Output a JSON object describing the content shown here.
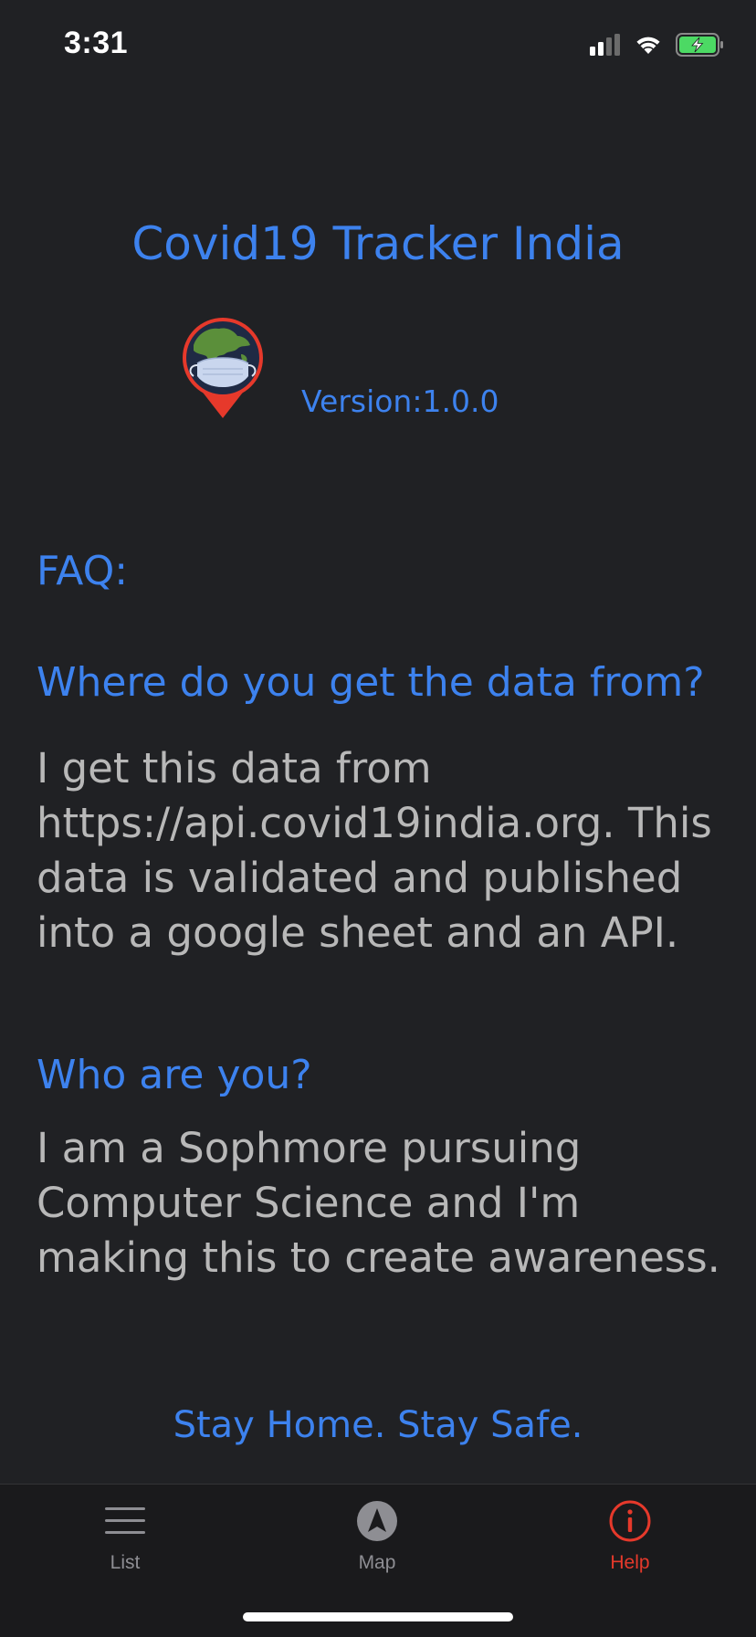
{
  "status_bar": {
    "time": "3:31",
    "icons": [
      "signal-icon",
      "wifi-icon",
      "battery-charging-icon"
    ],
    "battery_color": "#4cd964"
  },
  "header": {
    "title": "Covid19 Tracker India",
    "version": "Version:1.0.0"
  },
  "faq": {
    "heading": "FAQ:",
    "items": [
      {
        "question": "Where do you get the data from?",
        "answer": " I get this data from https://api.covid19india.org. This data is validated and published into a google sheet and an API."
      },
      {
        "question": "Who are you?",
        "answer": "I am a Sophmore pursuing Computer Science and I'm making this to create awareness."
      }
    ]
  },
  "footer": {
    "message": "Stay Home. Stay Safe."
  },
  "tab_bar": {
    "tabs": [
      {
        "label": "List",
        "icon": "list-icon",
        "active": false
      },
      {
        "label": "Map",
        "icon": "navigation-arrow-icon",
        "active": false
      },
      {
        "label": "Help",
        "icon": "info-icon",
        "active": true
      }
    ],
    "active_color": "#e6392b",
    "inactive_color": "#8e8e93"
  },
  "colors": {
    "background": "#202124",
    "accent": "#3d82ee",
    "body_text": "#b8b8b8"
  }
}
